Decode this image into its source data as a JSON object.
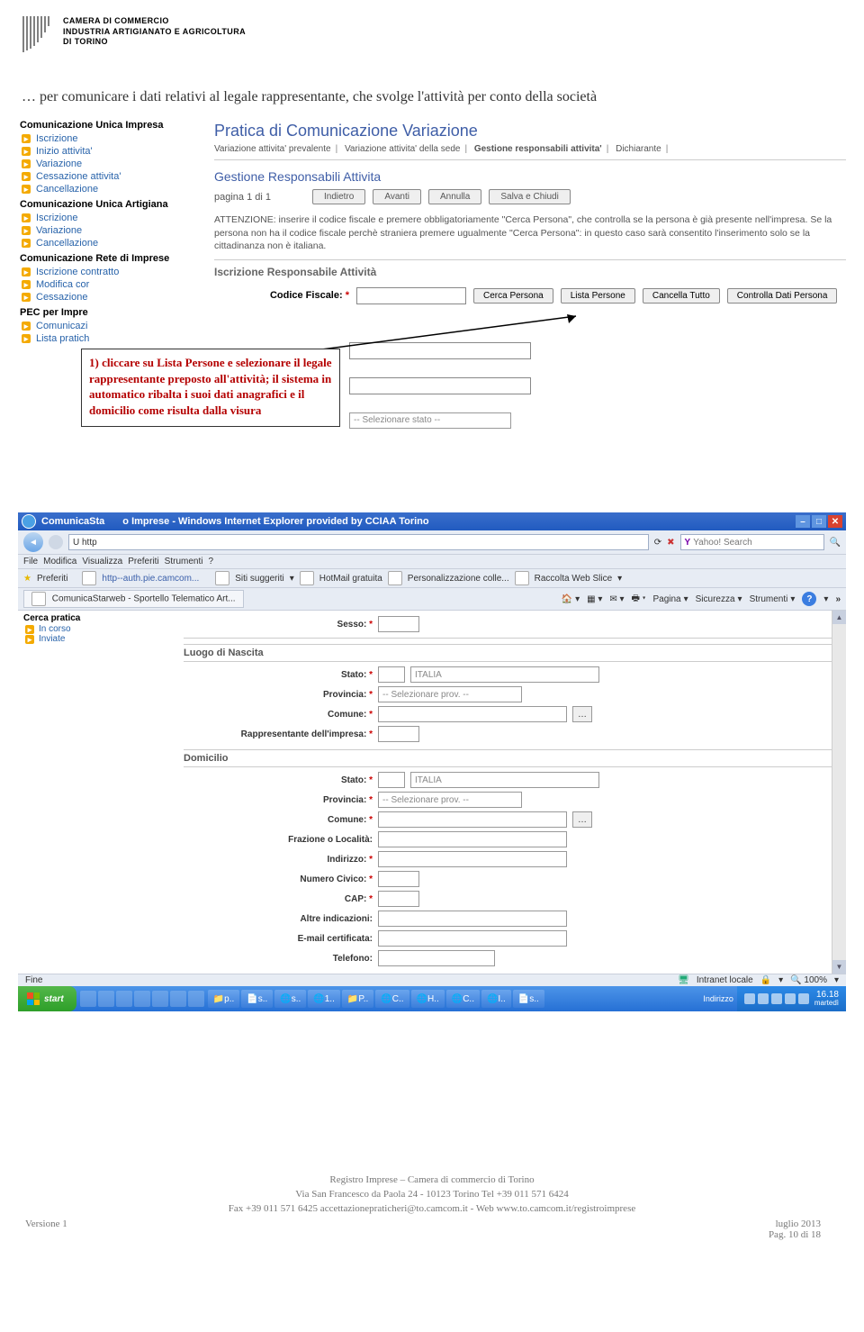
{
  "header": {
    "line1": "CAMERA DI COMMERCIO",
    "line2": "INDUSTRIA ARTIGIANATO E AGRICOLTURA",
    "line3": "DI TORINO"
  },
  "intro": "… per comunicare i dati relativi al legale rappresentante, che svolge l'attività per conto della società",
  "sidebar": {
    "g1_title": "Comunicazione Unica Impresa",
    "g1": [
      "Iscrizione",
      "Inizio attivita'",
      "Variazione",
      "Cessazione attivita'",
      "Cancellazione"
    ],
    "g2_title": "Comunicazione Unica Artigiana",
    "g2": [
      "Iscrizione",
      "Variazione",
      "Cancellazione"
    ],
    "g3_title": "Comunicazione Rete di Imprese",
    "g3": [
      "Iscrizione contratto",
      "Modifica cor",
      "Cessazione"
    ],
    "g4_title": "PEC per Impre",
    "g4": [
      "Comunicazi",
      "Lista pratich"
    ]
  },
  "form1": {
    "title": "Pratica di Comunicazione Variazione",
    "crumbs": [
      "Variazione attivita' prevalente",
      "Variazione attivita' della sede",
      "Gestione responsabili attivita'",
      "Dichiarante"
    ],
    "section": "Gestione Responsabili Attivita",
    "page_label": "pagina 1 di 1",
    "btn_prev": "Indietro",
    "btn_next": "Avanti",
    "btn_cancel": "Annulla",
    "btn_save": "Salva e Chiudi",
    "warn": "ATTENZIONE: inserire il codice fiscale e premere obbligatoriamente \"Cerca Persona\", che controlla se la persona è già presente nell'impresa. Se la persona non ha il codice fiscale perchè straniera premere ugualmente \"Cerca Persona\": in questo caso sarà consentito l'inserimento solo se la cittadinanza non è italiana.",
    "subsection": "Iscrizione Responsabile Attività",
    "cf_label": "Codice Fiscale:",
    "btn_cerca": "Cerca Persona",
    "btn_lista": "Lista Persone",
    "btn_canc": "Cancella Tutto",
    "btn_ctrl": "Controlla Dati Persona",
    "dropdown_placeholder": "-- Selezionare stato --"
  },
  "callout": "1) cliccare su Lista Persone e selezionare il legale rappresentante preposto all'attività; il sistema in automatico ribalta i suoi dati anagrafici e il domicilio come risulta dalla visura",
  "ie": {
    "title_left": "ComunicaSta",
    "title_right": "o Imprese - Windows Internet Explorer provided by CCIAA Torino",
    "url_prefix": "U http",
    "menu": [
      "File",
      "Modifica",
      "Visualizza",
      "Preferiti",
      "Strumenti",
      "?"
    ],
    "fav_star": "Preferiti",
    "fav_url": "http--auth.pie.camcom...",
    "fav_btns": [
      "Siti suggeriti",
      "HotMail gratuita",
      "Personalizzazione colle...",
      "Raccolta Web Slice"
    ],
    "tab": "ComunicaStarweb - Sportello Telematico Art...",
    "tools_right": [
      "Pagina",
      "Sicurezza",
      "Strumenti"
    ],
    "search_placeholder": "Yahoo! Search",
    "status_left": "Fine",
    "status_intranet": "Intranet locale",
    "status_zoom": "100%"
  },
  "cerca": {
    "title": "Cerca pratica",
    "items": [
      "In corso",
      "Inviate"
    ]
  },
  "form2": {
    "sesso": "Sesso:",
    "sect_nascita": "Luogo di Nascita",
    "stato": "Stato:",
    "italia": "ITALIA",
    "provincia": "Provincia:",
    "prov_placeholder": "-- Selezionare prov. --",
    "comune": "Comune:",
    "rappresentante": "Rappresentante dell'impresa:",
    "sect_domicilio": "Domicilio",
    "frazione": "Frazione o Località:",
    "indirizzo": "Indirizzo:",
    "civico": "Numero Civico:",
    "cap": "CAP:",
    "altre": "Altre indicazioni:",
    "email": "E-mail certificata:",
    "telefono": "Telefono:"
  },
  "taskbar": {
    "start": "start",
    "items": [
      "",
      "p..",
      "s..",
      "s..",
      "1..",
      "P..",
      "C..",
      "H..",
      "C..",
      "I..",
      "s.."
    ],
    "indirizzo": "Indirizzo",
    "time": "16.18",
    "day": "martedì"
  },
  "footer": {
    "l1": "Registro Imprese – Camera di commercio di Torino",
    "l2": "Via San Francesco da Paola 24 - 10123 Torino Tel +39 011 571 6424",
    "l3": "Fax +39 011 571 6425 accettazionepraticheri@to.camcom.it - Web www.to.camcom.it/registroimprese",
    "version": "Versione 1",
    "date": "luglio 2013",
    "page": "Pag. 10 di 18"
  }
}
